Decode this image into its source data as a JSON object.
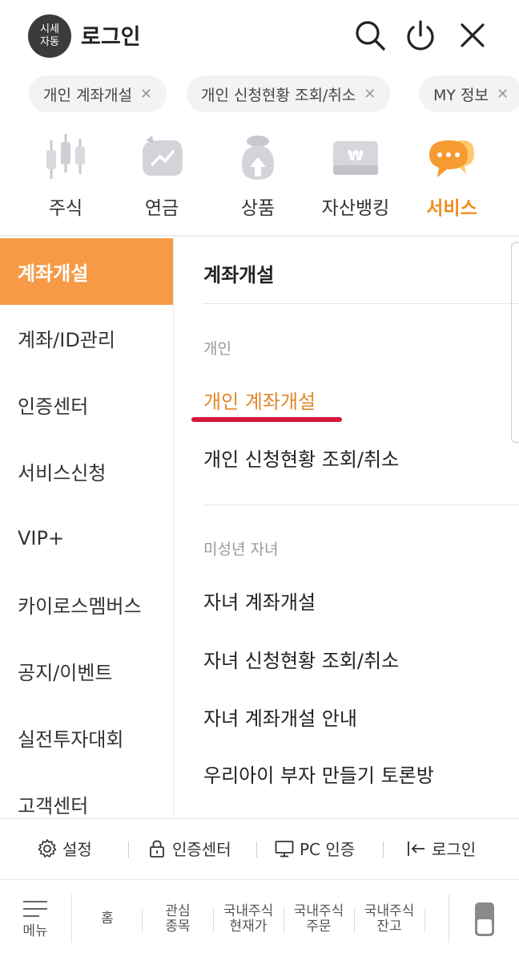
{
  "header": {
    "badge_line1": "시세",
    "badge_line2": "자동",
    "title": "로그인",
    "icons": [
      "search-icon",
      "power-icon",
      "close-icon"
    ]
  },
  "chips": [
    {
      "label": "개인 계좌개설"
    },
    {
      "label": "개인 신청현황 조회/취소"
    },
    {
      "label": "MY 정보"
    }
  ],
  "categories": [
    {
      "label": "주식",
      "icon": "candlestick-icon"
    },
    {
      "label": "연금",
      "icon": "piggy-bank-icon"
    },
    {
      "label": "상품",
      "icon": "money-bag-icon"
    },
    {
      "label": "자산뱅킹",
      "icon": "bank-card-icon"
    },
    {
      "label": "서비스",
      "icon": "chat-bubble-icon",
      "active": true
    }
  ],
  "sidebar": {
    "items": [
      {
        "label": "계좌개설",
        "active": true
      },
      {
        "label": "계좌/ID관리"
      },
      {
        "label": "인증센터"
      },
      {
        "label": "서비스신청"
      },
      {
        "label": "VIP+"
      },
      {
        "label": "카이로스멤버스"
      },
      {
        "label": "공지/이벤트"
      },
      {
        "label": "실전투자대회"
      },
      {
        "label": "고객센터"
      }
    ]
  },
  "content": {
    "title": "계좌개설",
    "sections": [
      {
        "label": "개인",
        "links": [
          "개인 계좌개설",
          "개인 신청현황 조회/취소"
        ]
      },
      {
        "label": "미성년 자녀",
        "links": [
          "자녀 계좌개설",
          "자녀 신청현황 조회/취소",
          "자녀 계좌개설 안내",
          "우리아이 부자 만들기 토론방"
        ]
      }
    ]
  },
  "utilbar": {
    "settings": "설정",
    "auth_center": "인증센터",
    "pc_auth": "PC 인증",
    "login": "로그인"
  },
  "tabbar": {
    "menu": "메뉴",
    "home": "홈",
    "watch_line1": "관심",
    "watch_line2": "종목",
    "price_line1": "국내주식",
    "price_line2": "현재가",
    "order_line1": "국내주식",
    "order_line2": "주문",
    "balance_line1": "국내주식",
    "balance_line2": "잔고"
  },
  "colors": {
    "accent": "#f08c1e",
    "sidebar_active": "#f79a46",
    "red_underline": "#d6173a"
  }
}
